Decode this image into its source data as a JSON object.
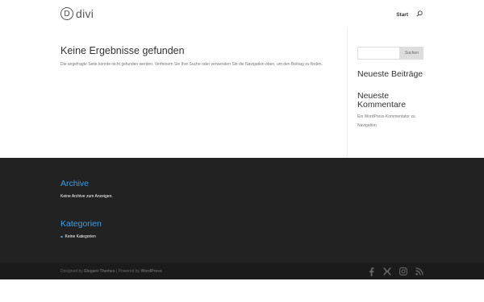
{
  "header": {
    "logo_letter": "D",
    "logo_text": "divi",
    "nav": [
      {
        "label": "Start"
      }
    ],
    "search_icon": "search-icon"
  },
  "main": {
    "title": "Keine Ergebnisse gefunden",
    "message": "Die angefragte Seite konnte nicht gefunden werden. Verfeinern Sie Ihre Suche oder verwenden Sie die Navigation oben, um den Beitrag zu finden."
  },
  "sidebar": {
    "search_placeholder": "",
    "search_button": "Suchen",
    "recent_posts_title": "Neueste Beiträge",
    "recent_comments_title": "Neueste Kommentare",
    "comment": {
      "author": "Ein WordPress-Kommentator",
      "connector": "zu",
      "post": "Navigation"
    }
  },
  "footer": {
    "archive_title": "Archive",
    "archive_text": "Keine Archive zum Anzeigen.",
    "categories_title": "Kategorien",
    "categories_item": "Keine Kategorien",
    "credits": {
      "designed_by": "Designed by",
      "theme_author": "Elegant Themes",
      "separator": "|",
      "powered_by": "Powered by",
      "platform": "WordPress"
    },
    "social": [
      "facebook-icon",
      "x-icon",
      "instagram-icon",
      "rss-icon"
    ]
  },
  "colors": {
    "accent": "#2ea3f2",
    "footer_bg": "#222222",
    "bottom_bar_bg": "#1b1b1b",
    "heading": "#333333"
  }
}
